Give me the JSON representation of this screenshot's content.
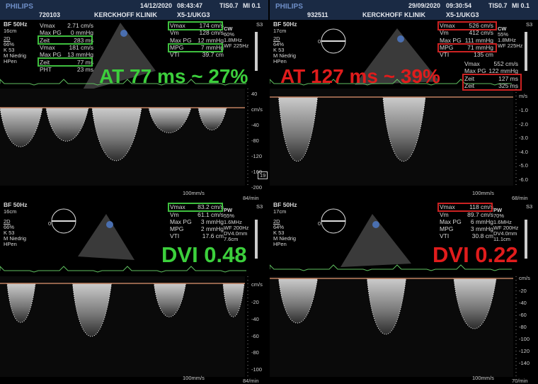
{
  "panels": [
    {
      "header": {
        "brand": "PHILIPS",
        "date": "14/12/2020",
        "time": "08:43:47",
        "tis": "TIS0.7",
        "mi": "MI 0.1",
        "patient_id": "720103",
        "clinic": "KERCKHOFF KLINIK",
        "probe": "X5-1/UKG3"
      },
      "settings": {
        "bf": "BF 50Hz",
        "depth": "16cm",
        "mode": "2D",
        "gain": "66%",
        "k": "K 53",
        "m": "M Niedrig",
        "hpen": "HPen"
      },
      "meas1": [
        {
          "label": "Vmax",
          "value": "2.71 cm/s"
        },
        {
          "label": "Max PG",
          "value": "0 mmHg"
        },
        {
          "label": "Zeit",
          "value": "283 ms"
        },
        {
          "label": "Vmax",
          "value": "181 cm/s"
        },
        {
          "label": "Max PG",
          "value": "13 mmHg"
        },
        {
          "label": "Zeit",
          "value": "77 ms"
        },
        {
          "label": "PHT",
          "value": "23 ms"
        }
      ],
      "meas2": [
        {
          "label": "Vmax",
          "value": "174 cm/s"
        },
        {
          "label": "Vm",
          "value": "128 cm/s"
        },
        {
          "label": "Max PG",
          "value": "12 mmHg"
        },
        {
          "label": "MPG",
          "value": "7 mmHg"
        },
        {
          "label": "VTI",
          "value": "39.7 cm"
        }
      ],
      "doppler": [
        "CW",
        "60%",
        "1.8MHz",
        "WF 225Hz"
      ],
      "s3": "S3",
      "annotation": "AT 77 ms ~ 27%",
      "annotation_color": "#3ccf3c",
      "scale": [
        "40",
        "cm/s",
        "-40",
        "-80",
        "-120",
        "-160",
        "-200"
      ],
      "sweep": "100mm/s",
      "hr": "84/min",
      "marker": "19"
    },
    {
      "header": {
        "brand": "PHILIPS",
        "date": "29/09/2020",
        "time": "09:30:54",
        "tis": "TIS0.7",
        "mi": "MI 0.1",
        "patient_id": "932511",
        "clinic": "KERCKHOFF KLINIK",
        "probe": "X5-1/UKG3"
      },
      "settings": {
        "bf": "BF 50Hz",
        "depth": "17cm",
        "mode": "2D",
        "gain": "64%",
        "k": "K 53",
        "m": "M Niedrig",
        "hpen": "HPen"
      },
      "angle": "0",
      "meas2": [
        {
          "label": "Vmax",
          "value": "526 cm/s"
        },
        {
          "label": "Vm",
          "value": "412 cm/s"
        },
        {
          "label": "Max PG",
          "value": "111 mmHg"
        },
        {
          "label": "MPG",
          "value": "71 mmHg"
        },
        {
          "label": "VTI",
          "value": "135 cm"
        }
      ],
      "meas3": [
        {
          "label": "Vmax",
          "value": "552 cm/s"
        },
        {
          "label": "Max PG",
          "value": "122 mmHg"
        },
        {
          "label": "Zeit",
          "value": "127 ms"
        },
        {
          "label": "Zeit",
          "value": "325 ms"
        }
      ],
      "doppler": [
        "CW",
        "55%",
        "1.8MHz",
        "WF 225Hz"
      ],
      "s3": "S3",
      "annotation": "AT 127 ms ~ 39%",
      "annotation_color": "#e01c1c",
      "scale": [
        "m/s",
        "-1.0",
        "-2.0",
        "-3.0",
        "-4.0",
        "-5.0",
        "-6.0"
      ],
      "sweep": "100mm/s",
      "hr": "68/min"
    },
    {
      "settings": {
        "bf": "BF 50Hz",
        "depth": "16cm",
        "mode": "2D",
        "gain": "66%",
        "k": "K 53",
        "m": "M Niedrig",
        "hpen": "HPen"
      },
      "angle": "0",
      "meas2": [
        {
          "label": "Vmax",
          "value": "83.2 cm/s"
        },
        {
          "label": "Vm",
          "value": "61.1 cm/s"
        },
        {
          "label": "Max PG",
          "value": "3 mmHg"
        },
        {
          "label": "MPG",
          "value": "2 mmHg"
        },
        {
          "label": "VTI",
          "value": "17.6 cm"
        }
      ],
      "doppler": [
        "PW",
        "55%",
        "1.6MHz",
        "WF 200Hz",
        "DV4.0mm",
        "7.6cm"
      ],
      "s3": "S3",
      "annotation": "DVI 0.48",
      "annotation_color": "#3ccf3c",
      "scale": [
        "cm/s",
        "-20",
        "-40",
        "-60",
        "-80",
        "-100"
      ],
      "sweep": "100mm/s",
      "hr": "84/min"
    },
    {
      "settings": {
        "bf": "BF 50Hz",
        "depth": "17cm",
        "mode": "2D",
        "gain": "64%",
        "k": "K 53",
        "m": "M Niedrig",
        "hpen": "HPen"
      },
      "angle": "0",
      "meas2": [
        {
          "label": "Vmax",
          "value": "118 cm/s"
        },
        {
          "label": "Vm",
          "value": "89.7 cm/s"
        },
        {
          "label": "Max PG",
          "value": "6 mmHg"
        },
        {
          "label": "MPG",
          "value": "3 mmHg"
        },
        {
          "label": "VTI",
          "value": "30.8 cm"
        }
      ],
      "doppler": [
        "PW",
        "70%",
        "1.6MHz",
        "WF 200Hz",
        "DV4.0mm",
        "11.1cm"
      ],
      "s3": "S3",
      "annotation": "DVI 0.22",
      "annotation_color": "#e01c1c",
      "scale": [
        "cm/s",
        "-20",
        "-40",
        "-60",
        "-80",
        "-100",
        "-120",
        "-140"
      ],
      "sweep": "100mm/s",
      "hr": "70/min"
    }
  ]
}
